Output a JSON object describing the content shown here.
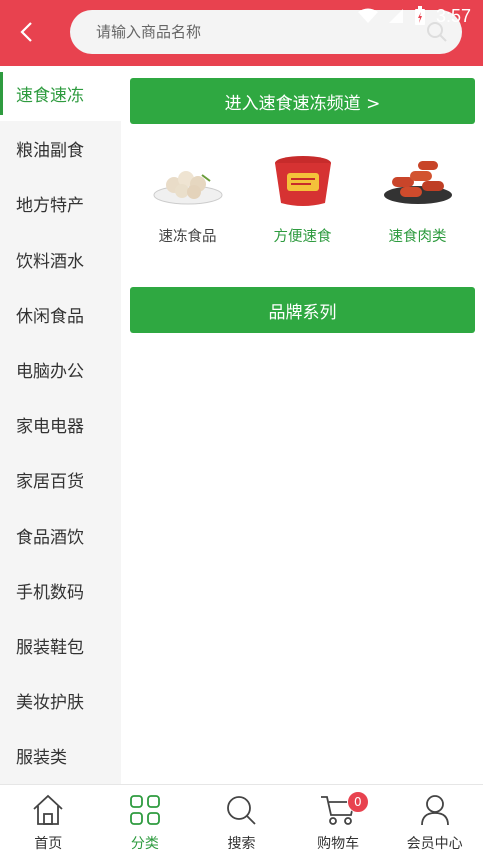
{
  "header": {
    "back_icon": "chevron-left-icon",
    "search_placeholder": "请输入商品名称"
  },
  "status_bar": {
    "time": "3:57"
  },
  "sidebar": {
    "items": [
      {
        "label": "速食速冻",
        "active": true
      },
      {
        "label": "粮油副食"
      },
      {
        "label": "地方特产"
      },
      {
        "label": "饮料酒水"
      },
      {
        "label": "休闲食品"
      },
      {
        "label": "电脑办公"
      },
      {
        "label": "家电电器"
      },
      {
        "label": "家居百货"
      },
      {
        "label": "食品酒饮"
      },
      {
        "label": "手机数码"
      },
      {
        "label": "服装鞋包"
      },
      {
        "label": "美妆护肤"
      },
      {
        "label": "服装类"
      }
    ]
  },
  "main": {
    "enter_channel": "进入速食速冻频道 >",
    "products": [
      {
        "name": "速冻食品",
        "icon": "meatball-plate-icon"
      },
      {
        "name": "方便速食",
        "icon": "instant-noodle-cup-icon"
      },
      {
        "name": "速食肉类",
        "icon": "sausage-plate-icon"
      }
    ],
    "brand_series": "品牌系列"
  },
  "tabbar": {
    "items": [
      {
        "label": "首页",
        "icon": "home-icon"
      },
      {
        "label": "分类",
        "icon": "category-icon",
        "active": true
      },
      {
        "label": "搜索",
        "icon": "search-icon"
      },
      {
        "label": "购物车",
        "icon": "cart-icon",
        "badge": "0"
      },
      {
        "label": "会员中心",
        "icon": "user-icon"
      }
    ]
  },
  "colors": {
    "header": "#e8424f",
    "accent_green": "#2fa841",
    "sidebar_bg": "#f5f5f5"
  }
}
